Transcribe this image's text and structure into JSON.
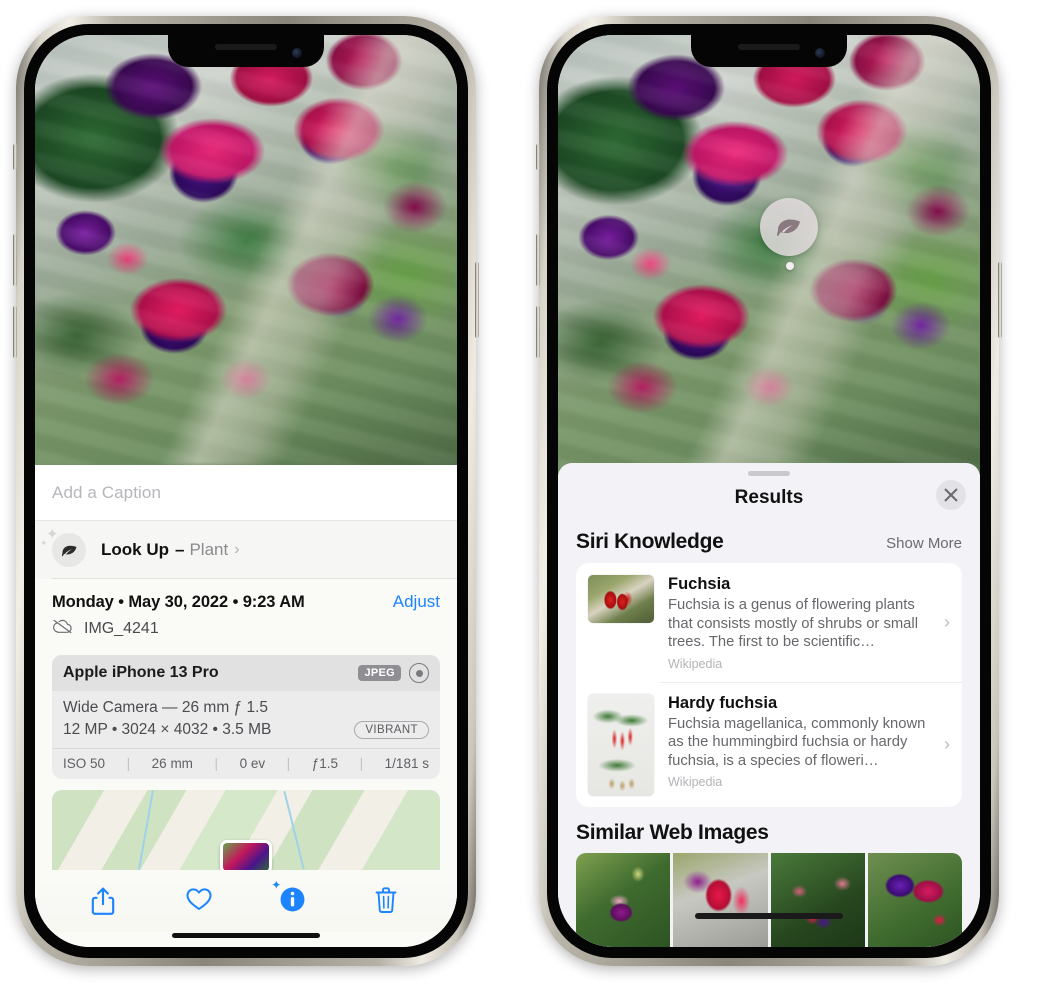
{
  "left_phone": {
    "caption_field": {
      "placeholder": "Add a Caption",
      "value": ""
    },
    "lookup_row": {
      "icon": "leaf-icon",
      "label": "Look Up",
      "dash": "–",
      "value": "Plant",
      "chevron": "›"
    },
    "details": {
      "datetime": "Monday • May 30, 2022 • 9:23 AM",
      "adjust_label": "Adjust",
      "cloud_icon": "icloud-slash-icon",
      "filename": "IMG_4241"
    },
    "exif": {
      "device": "Apple iPhone 13 Pro",
      "format_tag": "JPEG",
      "raw_icon": "raw-ring-icon",
      "lens": "Wide Camera — 26 mm ƒ 1.5",
      "specs": "12 MP • 3024 × 4032 • 3.5 MB",
      "style_pill": "VIBRANT",
      "footer": [
        "ISO 50",
        "26 mm",
        "0 ev",
        "ƒ1.5",
        "1/181 s"
      ],
      "footer_separator": "|"
    },
    "map": {
      "pin": "photo-thumbnail-pin"
    },
    "toolbar": [
      {
        "name": "share-icon",
        "glyph": "share"
      },
      {
        "name": "heart-icon",
        "glyph": "heart"
      },
      {
        "name": "info-icon",
        "glyph": "info"
      },
      {
        "name": "trash-icon",
        "glyph": "trash"
      }
    ]
  },
  "right_phone": {
    "visual_lookup_badge": {
      "icon": "leaf-icon"
    },
    "sheet": {
      "title": "Results",
      "close_label": "✕"
    },
    "siri_knowledge": {
      "title": "Siri Knowledge",
      "show_more": "Show More",
      "items": [
        {
          "title": "Fuchsia",
          "description": "Fuchsia is a genus of flowering plants that consists mostly of shrubs or small trees. The first to be scientific…",
          "source": "Wikipedia",
          "chevron": "›"
        },
        {
          "title": "Hardy fuchsia",
          "description": "Fuchsia magellanica, commonly known as the hummingbird fuchsia or hardy fuchsia, is a species of floweri…",
          "source": "Wikipedia",
          "chevron": "›"
        }
      ]
    },
    "similar_web_images": {
      "title": "Similar Web Images",
      "items": [
        {
          "alt": "pink-fuchsia-with-leaves"
        },
        {
          "alt": "red-purple-fuchsia-closeup"
        },
        {
          "alt": "fuchsia-bush-with-buds"
        },
        {
          "alt": "purple-red-double-fuchsia"
        }
      ]
    }
  },
  "colors": {
    "accent_blue": "#1d84ff",
    "sheet_background": "#f2f2f7",
    "info_sheet_background": "#fafaf7",
    "card_white": "#ffffff",
    "secondary_text": "#67676c",
    "tertiary_text": "#b3b3b8"
  }
}
